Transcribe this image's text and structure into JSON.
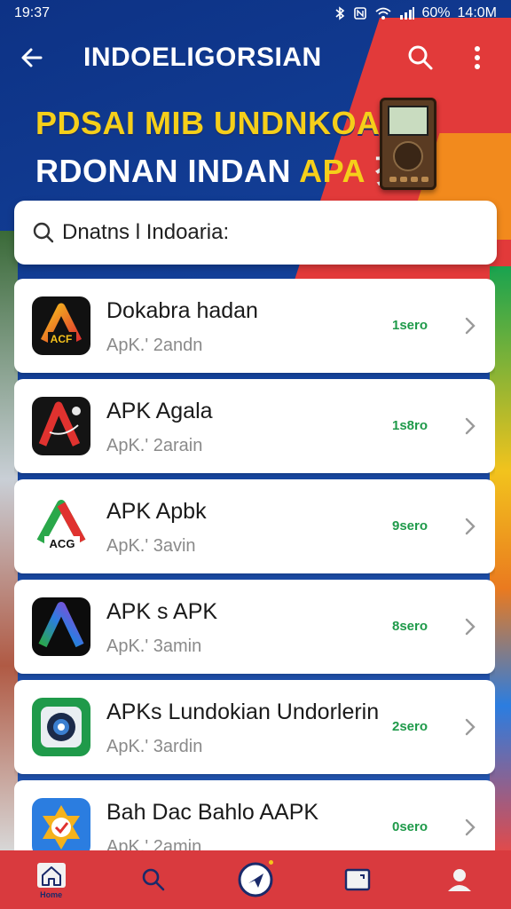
{
  "status_bar": {
    "time": "19:37",
    "battery": "60%",
    "right_time": "14:0M",
    "icons": [
      "bluetooth-icon",
      "nfc-icon",
      "wifi-icon",
      "signal-icon"
    ]
  },
  "app_bar": {
    "title": "INDOELIGORSIAN",
    "icons": [
      "back-arrow-icon",
      "search-icon",
      "more-vert-icon"
    ]
  },
  "banner": {
    "line1": "PDSAI MIB UNDNKOAN",
    "line2_main": "RDONAN INDAN ",
    "line2_highlight": "APA ",
    "line2_tail": "⽍."
  },
  "search": {
    "value": "Dnatns l Indoaria:",
    "icon": "search-icon"
  },
  "apps": [
    {
      "name": "Dokabra hadan",
      "subtitle": "ApK.' 2andn",
      "size": "1sero",
      "icon": "acf-logo-icon"
    },
    {
      "name": "APK Agala",
      "subtitle": "ApK.' 2arain",
      "size": "1s8ro",
      "icon": "a-logo-icon"
    },
    {
      "name": "APK Apbk",
      "subtitle": "ApK.' 3avin",
      "size": "9sero",
      "icon": "acg-logo-icon"
    },
    {
      "name": "APK s APK",
      "subtitle": "ApK.' 3amin",
      "size": "8sero",
      "icon": "gradient-a-icon"
    },
    {
      "name": "APKs Lundokian Undorlerin",
      "subtitle": "ApK.' 3ardin",
      "size": "2sero",
      "icon": "speaker-icon"
    },
    {
      "name": "Bah Dac Bahlo AAPK",
      "subtitle": "ApK.' 2amin",
      "size": "0sero",
      "icon": "badge-icon"
    }
  ],
  "bottom_nav": {
    "home_label": "Home",
    "items": [
      "home-icon",
      "search-icon",
      "explore-icon",
      "tablet-icon",
      "profile-icon"
    ]
  },
  "colors": {
    "primary_blue": "#0d3285",
    "accent_red": "#d93a3e",
    "banner_yellow": "#f5cf1a",
    "size_green": "#1f9a4a"
  }
}
